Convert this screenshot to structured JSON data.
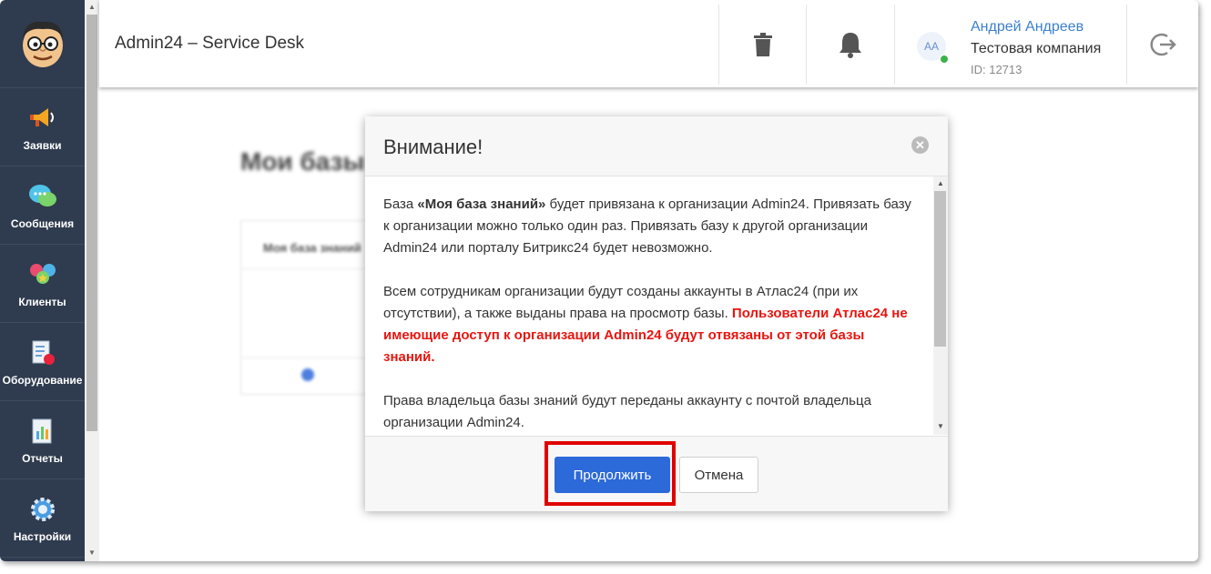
{
  "app": {
    "title": "Admin24 – Service Desk"
  },
  "sidebar": {
    "logo": "cartoon-face-logo",
    "items": [
      {
        "label": "Заявки",
        "icon": "megaphone-icon"
      },
      {
        "label": "Сообщения",
        "icon": "chat-bubbles-icon"
      },
      {
        "label": "Клиенты",
        "icon": "clients-icon"
      },
      {
        "label": "Оборудование",
        "icon": "equipment-icon"
      },
      {
        "label": "Отчеты",
        "icon": "reports-icon"
      },
      {
        "label": "Настройки",
        "icon": "gear-icon"
      }
    ]
  },
  "header": {
    "trash_icon": "trash-icon",
    "bell_icon": "bell-icon",
    "user": {
      "initials": "AA",
      "name": "Андрей Андреев",
      "company": "Тестовая компания",
      "id_text": "ID: 12713"
    },
    "logout_icon": "logout-icon"
  },
  "background": {
    "page_title": "Мои базы знаний",
    "card_header": "Моя база знаний"
  },
  "modal": {
    "title": "Внимание!",
    "p1_pre": "База ",
    "p1_bold": "«Моя база знаний»",
    "p1_post": " будет привязана к организации Admin24. Привязать базу к организации можно только один раз. Привязать базу к другой организации Admin24 или порталу Битрикс24 будет невозможно.",
    "p2_normal": "Всем сотрудникам организации будут созданы аккаунты в Атлас24 (при их отсутствии), а также выданы права на просмотр базы. ",
    "p2_red": "Пользователи Атлас24 не имеющие доступ к организации Admin24 будут отвязаны от этой базы знаний.",
    "p3": "Права владельца базы знаний будут переданы аккаунту с почтой владельца организации Admin24.",
    "continue_label": "Продолжить",
    "cancel_label": "Отмена"
  },
  "colors": {
    "sidebar_bg": "#2f3b4e",
    "primary": "#2c69d9",
    "warning_red": "#e8150f",
    "highlight": "#e10000",
    "user_link": "#3b7fd0"
  }
}
